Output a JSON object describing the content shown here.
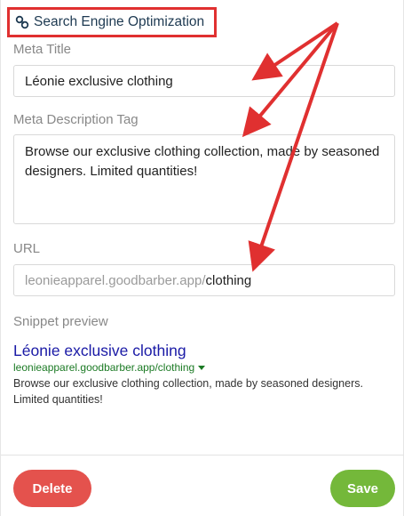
{
  "section": {
    "title": "Search Engine Optimization",
    "icon": "link-icon"
  },
  "meta_title": {
    "label": "Meta Title",
    "value": "Léonie exclusive clothing"
  },
  "meta_description": {
    "label": "Meta Description Tag",
    "value": "Browse our exclusive clothing collection, made by seasoned designers. Limited quantities!"
  },
  "url": {
    "label": "URL",
    "prefix": "leonieapparel.goodbarber.app/",
    "slug": "clothing"
  },
  "snippet": {
    "label": "Snippet preview",
    "title": "Léonie exclusive clothing",
    "url": "leonieapparel.goodbarber.app/clothing",
    "description": "Browse our exclusive clothing collection, made by seasoned designers. Limited quantities!"
  },
  "buttons": {
    "delete": "Delete",
    "save": "Save"
  },
  "colors": {
    "annotation": "#e03030",
    "delete": "#e4524d",
    "save": "#74b83a",
    "snippet_title": "#1a1aa6",
    "snippet_url": "#1b7a24"
  }
}
